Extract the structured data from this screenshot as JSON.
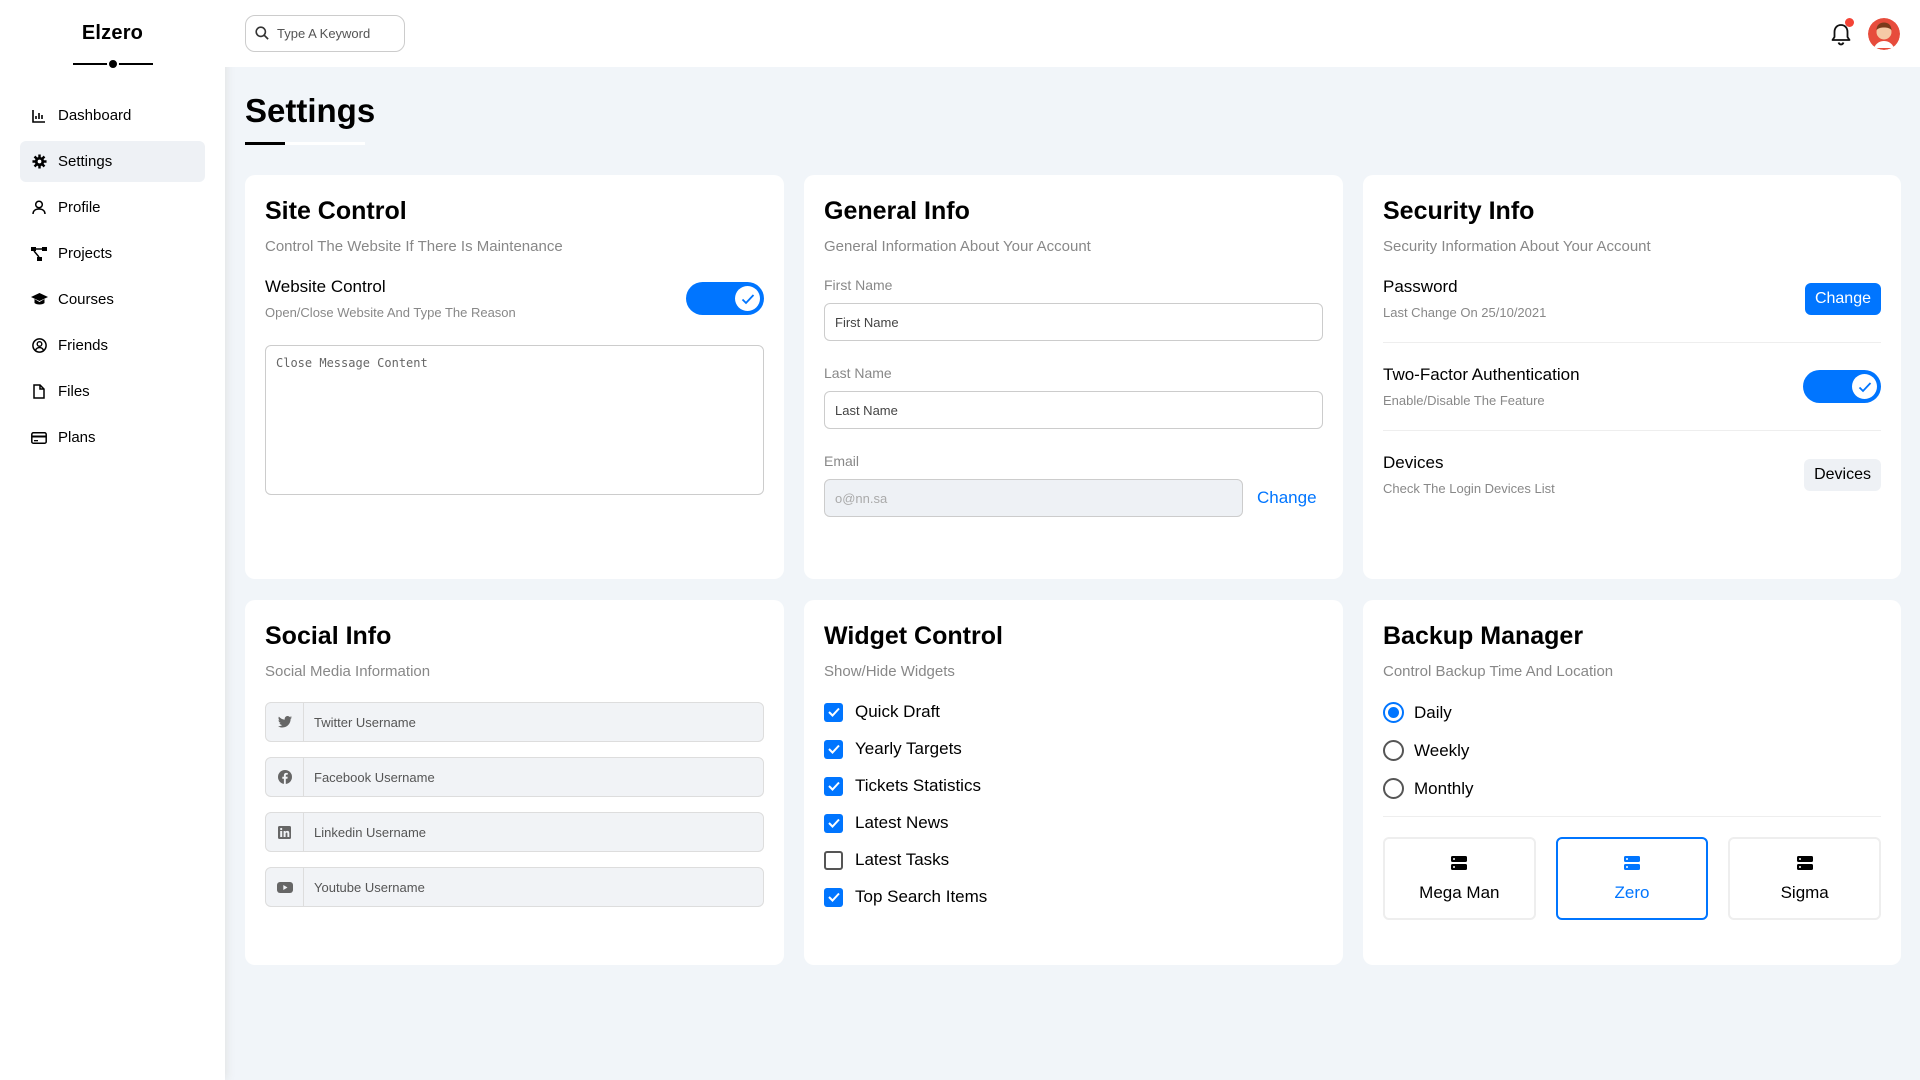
{
  "sidebar": {
    "brand": "Elzero",
    "items": [
      {
        "label": "Dashboard",
        "icon": "chart-icon"
      },
      {
        "label": "Settings",
        "icon": "gear-icon"
      },
      {
        "label": "Profile",
        "icon": "user-icon"
      },
      {
        "label": "Projects",
        "icon": "diagram-icon"
      },
      {
        "label": "Courses",
        "icon": "graduation-cap-icon"
      },
      {
        "label": "Friends",
        "icon": "circle-user-icon"
      },
      {
        "label": "Files",
        "icon": "file-icon"
      },
      {
        "label": "Plans",
        "icon": "credit-card-icon"
      }
    ],
    "active_index": 1
  },
  "header": {
    "search_placeholder": "Type A Keyword",
    "notification_dot_color": "#f44336"
  },
  "page": {
    "title": "Settings"
  },
  "site_control": {
    "title": "Site Control",
    "subtitle": "Control The Website If There Is Maintenance",
    "row_title": "Website Control",
    "row_desc": "Open/Close Website And Type The Reason",
    "toggle_on": true,
    "message_placeholder": "Close Message Content"
  },
  "general_info": {
    "title": "General Info",
    "subtitle": "General Information About Your Account",
    "first_name_label": "First Name",
    "first_name_placeholder": "First Name",
    "last_name_label": "Last Name",
    "last_name_placeholder": "Last Name",
    "email_label": "Email",
    "email_placeholder": "o@nn.sa",
    "change_label": "Change"
  },
  "security_info": {
    "title": "Security Info",
    "subtitle": "Security Information About Your Account",
    "password_title": "Password",
    "password_desc": "Last Change On 25/10/2021",
    "password_button": "Change",
    "twofa_title": "Two-Factor Authentication",
    "twofa_desc": "Enable/Disable The Feature",
    "twofa_on": true,
    "devices_title": "Devices",
    "devices_desc": "Check The Login Devices List",
    "devices_button": "Devices"
  },
  "social_info": {
    "title": "Social Info",
    "subtitle": "Social Media Information",
    "fields": [
      {
        "icon": "twitter-icon",
        "placeholder": "Twitter Username"
      },
      {
        "icon": "facebook-icon",
        "placeholder": "Facebook Username"
      },
      {
        "icon": "linkedin-icon",
        "placeholder": "Linkedin Username"
      },
      {
        "icon": "youtube-icon",
        "placeholder": "Youtube Username"
      }
    ]
  },
  "widget_control": {
    "title": "Widget Control",
    "subtitle": "Show/Hide Widgets",
    "items": [
      {
        "label": "Quick Draft",
        "checked": true
      },
      {
        "label": "Yearly Targets",
        "checked": true
      },
      {
        "label": "Tickets Statistics",
        "checked": true
      },
      {
        "label": "Latest News",
        "checked": true
      },
      {
        "label": "Latest Tasks",
        "checked": false
      },
      {
        "label": "Top Search Items",
        "checked": true
      }
    ]
  },
  "backup_manager": {
    "title": "Backup Manager",
    "subtitle": "Control Backup Time And Location",
    "options": [
      {
        "label": "Daily",
        "selected": true
      },
      {
        "label": "Weekly",
        "selected": false
      },
      {
        "label": "Monthly",
        "selected": false
      }
    ],
    "servers": [
      {
        "label": "Mega Man",
        "selected": false
      },
      {
        "label": "Zero",
        "selected": true
      },
      {
        "label": "Sigma",
        "selected": false
      }
    ]
  },
  "colors": {
    "accent": "#0075ff",
    "background": "#f1f5f9"
  }
}
